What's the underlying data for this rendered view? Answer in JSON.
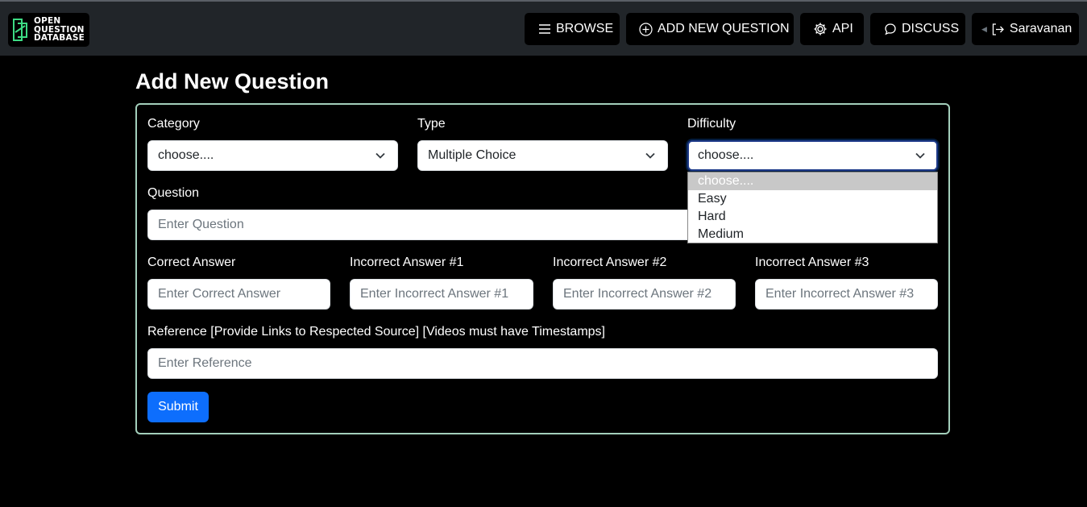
{
  "logo": {
    "line1": "OPEN",
    "line2": "QUESTION",
    "line3": "DATABASE"
  },
  "nav": {
    "browse": "BROWSE",
    "add_new_question": "ADD NEW QUESTION",
    "api": "API",
    "discuss": "DISCUSS",
    "user": "Saravanan"
  },
  "page_title": "Add New Question",
  "form": {
    "category": {
      "label": "Category",
      "value": "choose...."
    },
    "type": {
      "label": "Type",
      "value": "Multiple Choice"
    },
    "difficulty": {
      "label": "Difficulty",
      "value": "choose....",
      "options": [
        "choose....",
        "Easy",
        "Hard",
        "Medium"
      ]
    },
    "question": {
      "label": "Question",
      "placeholder": "Enter Question"
    },
    "correct_answer": {
      "label": "Correct Answer",
      "placeholder": "Enter Correct Answer"
    },
    "incorrect_1": {
      "label": "Incorrect Answer #1",
      "placeholder": "Enter Incorrect Answer #1"
    },
    "incorrect_2": {
      "label": "Incorrect Answer #2",
      "placeholder": "Enter Incorrect Answer #2"
    },
    "incorrect_3": {
      "label": "Incorrect Answer #3",
      "placeholder": "Enter Incorrect Answer #3"
    },
    "reference": {
      "label": "Reference [Provide Links to Respected Source] [Videos must have Timestamps]",
      "placeholder": "Enter Reference"
    },
    "submit": "Submit"
  },
  "colors": {
    "primary": "#0d6efd",
    "card_border": "#a3cfbb",
    "navbar": "#212529",
    "logo_accent": "#3ddc84"
  },
  "icons": [
    "logo-mark-icon",
    "menu-icon",
    "plus-circle-icon",
    "gear-icon",
    "chat-icon",
    "logout-icon",
    "chevron-down-icon"
  ]
}
